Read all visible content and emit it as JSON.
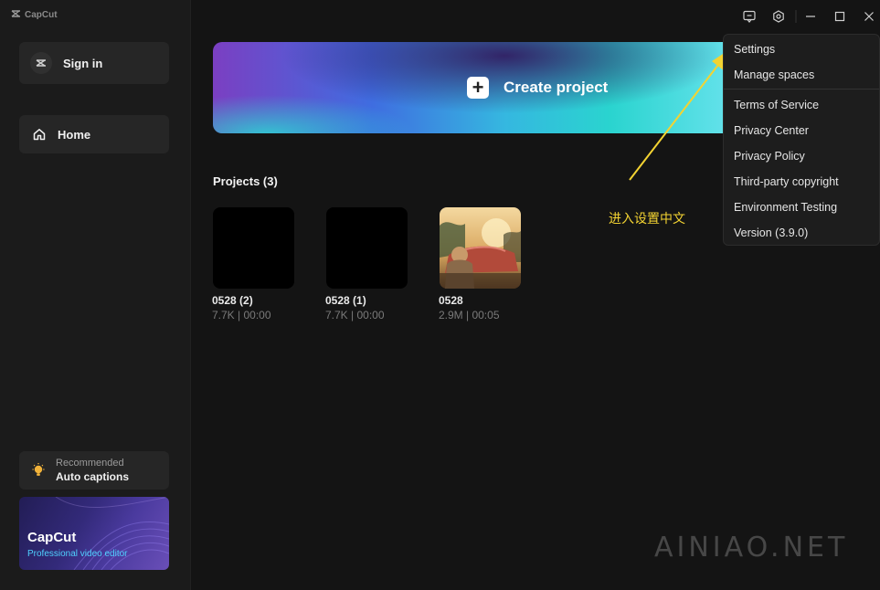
{
  "app": {
    "title": "CapCut"
  },
  "sidebar": {
    "sign_in": "Sign in",
    "home": "Home",
    "recommended": {
      "small": "Recommended",
      "big": "Auto captions"
    },
    "promo": {
      "title": "CapCut",
      "subtitle": "Professional video editor"
    }
  },
  "main": {
    "create_label": "Create project",
    "projects_title": "Projects  (3)",
    "projects": [
      {
        "name": "0528 (2)",
        "meta": "7.7K | 00:00"
      },
      {
        "name": "0528 (1)",
        "meta": "7.7K | 00:00"
      },
      {
        "name": "0528",
        "meta": "2.9M | 00:05"
      }
    ]
  },
  "menu": {
    "items": [
      "Settings",
      "Manage spaces",
      "Terms of Service",
      "Privacy Center",
      "Privacy Policy",
      "Third-party copyright",
      "Environment Testing",
      "Version (3.9.0)"
    ]
  },
  "annotation": {
    "text": "进入设置中文",
    "color": "#f3d332"
  },
  "watermark": "AINIAO.NET",
  "colors": {
    "background": "#141414",
    "sidebar": "#1b1b1b",
    "accent": "#4fd1ff"
  }
}
